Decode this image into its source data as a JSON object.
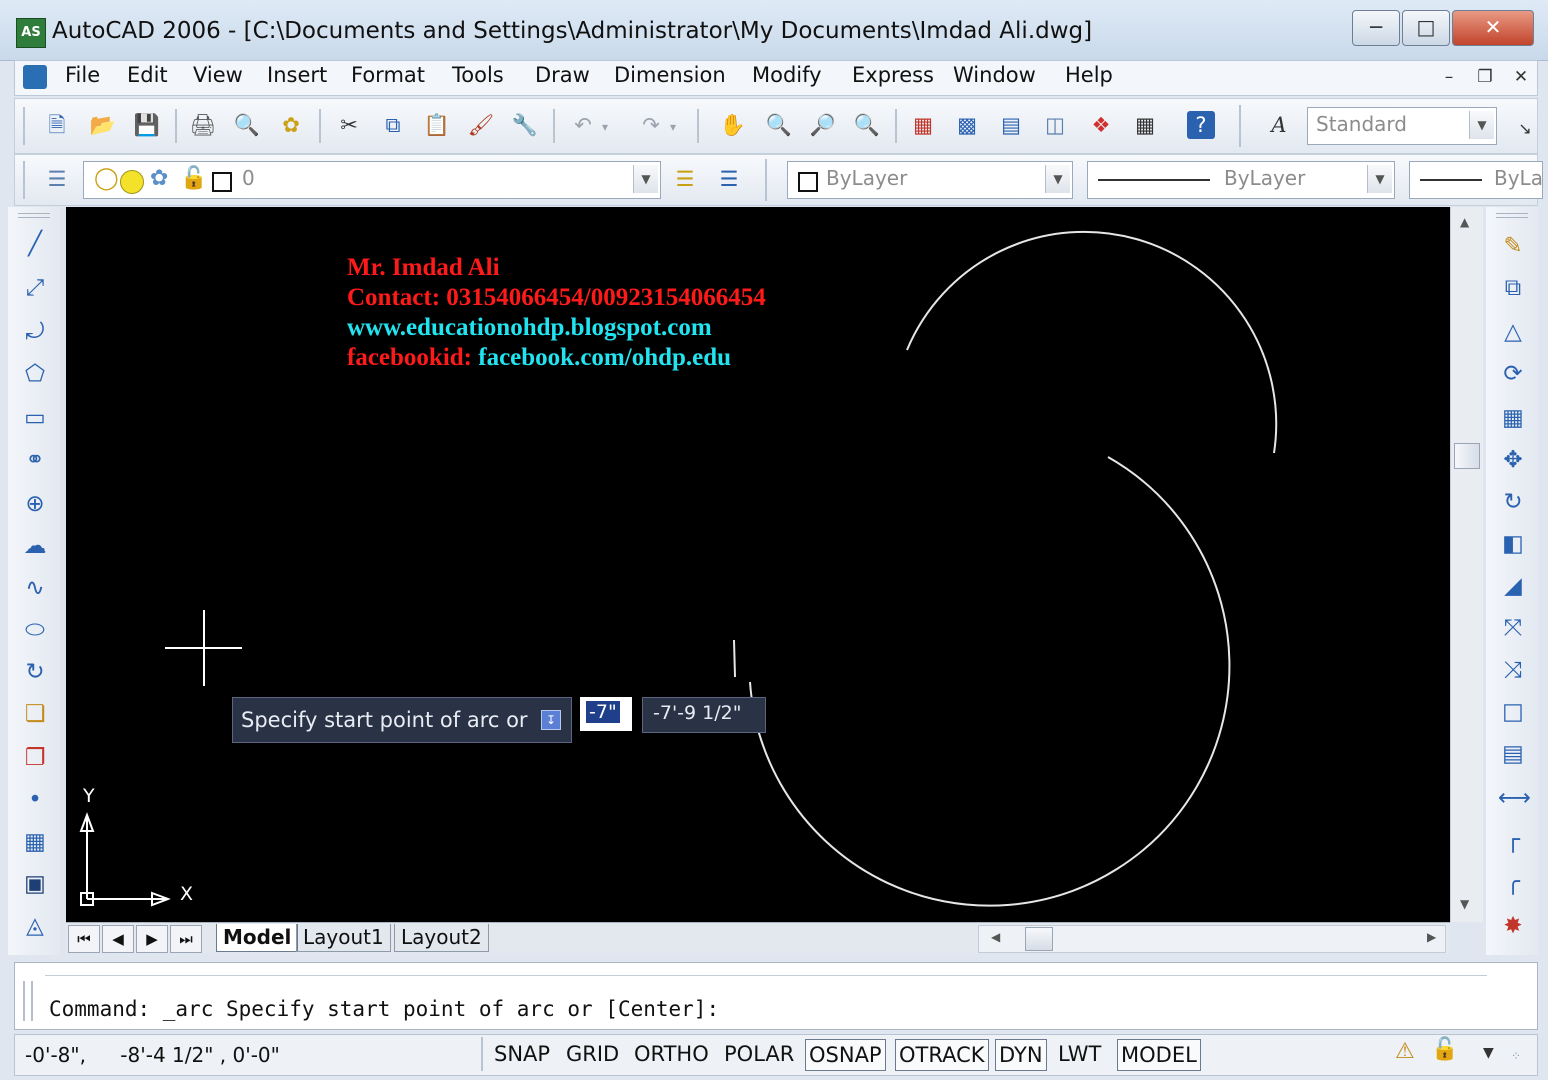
{
  "window": {
    "title": "AutoCAD 2006 - [C:\\Documents and Settings\\Administrator\\My Documents\\Imdad Ali.dwg]",
    "app_icon_label": "AS"
  },
  "menu": {
    "items": [
      "File",
      "Edit",
      "View",
      "Insert",
      "Format",
      "Tools",
      "Draw",
      "Dimension",
      "Modify",
      "Express",
      "Window",
      "Help"
    ]
  },
  "standard_toolbar": {
    "text_style": "Standard"
  },
  "layers_toolbar": {
    "layer_name": "0",
    "color": "ByLayer",
    "linetype": "ByLayer",
    "lineweight": "ByLa"
  },
  "overlay": {
    "line1": "Mr. Imdad Ali",
    "line2": "Contact: 03154066454/00923154066454",
    "line3": "www.educationohdp.blogspot.com",
    "line4_label": "facebookid: ",
    "line4_value": "facebook.com/ohdp.edu",
    "red": "#ff1a1a",
    "cyan": "#22e3f0"
  },
  "dynamic_input": {
    "prompt": "Specify start point of arc or",
    "x_value": "-7\"",
    "y_value": "-7'-9 1/2\""
  },
  "ucs": {
    "x_label": "X",
    "y_label": "Y"
  },
  "tabs": [
    "Model",
    "Layout1",
    "Layout2"
  ],
  "command_line": "Command: _arc Specify start point of arc or [Center]:",
  "status": {
    "coordinates_x": "-0'-8\",",
    "coordinates_rest": "-8'-4 1/2\" , 0'-0\"",
    "toggles": [
      {
        "label": "SNAP",
        "on": false
      },
      {
        "label": "GRID",
        "on": false
      },
      {
        "label": "ORTHO",
        "on": false
      },
      {
        "label": "POLAR",
        "on": false
      },
      {
        "label": "OSNAP",
        "on": true
      },
      {
        "label": "OTRACK",
        "on": true
      },
      {
        "label": "DYN",
        "on": true
      },
      {
        "label": "LWT",
        "on": false
      },
      {
        "label": "MODEL",
        "on": true
      }
    ]
  },
  "icons": {
    "standard": [
      "new-icon",
      "open-icon",
      "save-icon",
      "plot-icon",
      "plot-preview-icon",
      "publish-icon",
      "cut-icon",
      "copy-icon",
      "paste-icon",
      "match-properties-icon",
      "block-editor-icon",
      "undo-icon",
      "redo-icon",
      "pan-icon",
      "zoom-realtime-icon",
      "zoom-window-icon",
      "zoom-previous-icon",
      "properties-icon",
      "design-center-icon",
      "tool-palettes-icon",
      "sheet-set-icon",
      "markup-icon",
      "quickcalc-icon",
      "help-icon",
      "text-style-icon"
    ],
    "draw": [
      "line-icon",
      "construction-line-icon",
      "polyline-icon",
      "polygon-icon",
      "rectangle-icon",
      "arc-icon",
      "circle-icon",
      "revision-cloud-icon",
      "spline-icon",
      "ellipse-icon",
      "ellipse-arc-icon",
      "insert-block-icon",
      "make-block-icon",
      "point-icon",
      "hatch-icon",
      "gradient-icon",
      "region-icon"
    ],
    "modify": [
      "erase-icon",
      "copy-object-icon",
      "mirror-icon",
      "offset-icon",
      "array-icon",
      "move-icon",
      "rotate-icon",
      "scale-icon",
      "stretch-icon",
      "trim-icon",
      "extend-icon",
      "break-at-point-icon",
      "break-icon",
      "join-icon",
      "chamfer-icon",
      "fillet-icon",
      "explode-icon"
    ]
  }
}
